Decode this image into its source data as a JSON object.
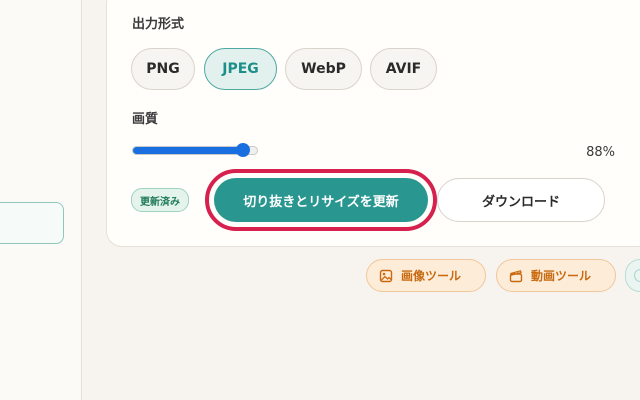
{
  "output_format": {
    "label": "出力形式",
    "options": [
      "PNG",
      "JPEG",
      "WebP",
      "AVIF"
    ],
    "selected": "JPEG"
  },
  "quality": {
    "label": "画質",
    "value": 88,
    "value_text": "88%"
  },
  "actions": {
    "status_badge": "更新済み",
    "apply_label": "切り抜きとリサイズを更新",
    "download_label": "ダウンロード"
  },
  "tools": {
    "image_tool": "画像ツール",
    "video_tool": "動画ツール"
  },
  "icons": [
    "image-icon",
    "clapperboard-icon"
  ],
  "colors": {
    "accent": "#2a9690",
    "highlight_ring": "#d6204e",
    "slider": "#1a6fe0",
    "tool_chip": "#c96a10"
  }
}
